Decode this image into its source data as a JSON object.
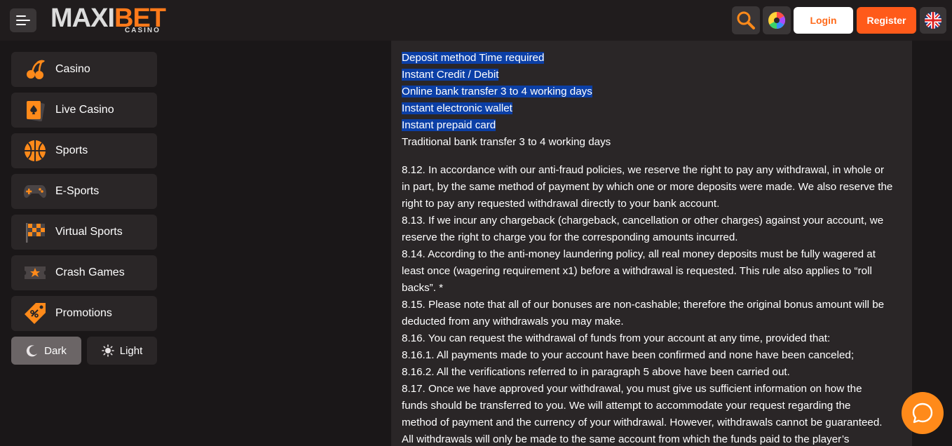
{
  "header": {
    "logo_main_a": "MAXI",
    "logo_main_b": "BET",
    "logo_sub": "CASINO",
    "login_label": "Login",
    "register_label": "Register"
  },
  "sidebar": {
    "items": [
      {
        "label": "Casino",
        "icon": "cherries-icon"
      },
      {
        "label": "Live Casino",
        "icon": "playing-card-icon"
      },
      {
        "label": "Sports",
        "icon": "basketball-icon"
      },
      {
        "label": "E-Sports",
        "icon": "gamepad-icon"
      },
      {
        "label": "Virtual Sports",
        "icon": "checkered-flag-icon"
      },
      {
        "label": "Crash Games",
        "icon": "ticket-icon"
      },
      {
        "label": "Promotions",
        "icon": "price-tag-icon"
      }
    ],
    "theme_dark": "Dark",
    "theme_light": "Light"
  },
  "content": {
    "highlighted": [
      "Deposit method Time required",
      "Instant Credit / Debit",
      "Online bank transfer 3 to 4 working days",
      "Instant electronic wallet",
      "Instant prepaid card"
    ],
    "plain_line": "Traditional bank transfer 3 to 4 working days",
    "lines": [
      "8.12. In accordance with our anti-fraud policies, we reserve the right to pay any withdrawal, in whole or",
      "in part, by the same method of payment by which one or more deposits were made. We also reserve the",
      "right to pay any requested withdrawal directly to your bank account.",
      "8.13. If we incur any chargeback (chargeback, cancellation or other charges) against your account, we",
      "reserve the right to charge you for the corresponding amounts incurred.",
      "8.14. According to the anti-money laundering policy, all real money deposits must be fully wagered at",
      "least once (wagering requirement x1) before a withdrawal is requested. This rule also applies to “roll",
      "backs”. *",
      "8.15. Please note that all of our bonuses are non-cashable; therefore the original bonus amount will be",
      "deducted from any withdrawals you may make.",
      "8.16. You can request the withdrawal of funds from your account at any time, provided that:",
      "8.16.1. All payments made to your account have been confirmed and none have been canceled;",
      "8.16.2. All the verifications referred to in paragraph 5 above have been carried out.",
      "8.17. Once we have approved your withdrawal, you must give us sufficient information on how the",
      "funds should be transferred to you. We will attempt to accommodate your request regarding the",
      "method of payment and the currency of your withdrawal. However, withdrawals cannot be guaranteed.",
      "All withdrawals will only be made to the same account from which the funds paid to the player’s"
    ]
  },
  "colors": {
    "accent": "#ff7a1a",
    "register": "#ff5a1a",
    "highlight": "#0b3fa6"
  }
}
